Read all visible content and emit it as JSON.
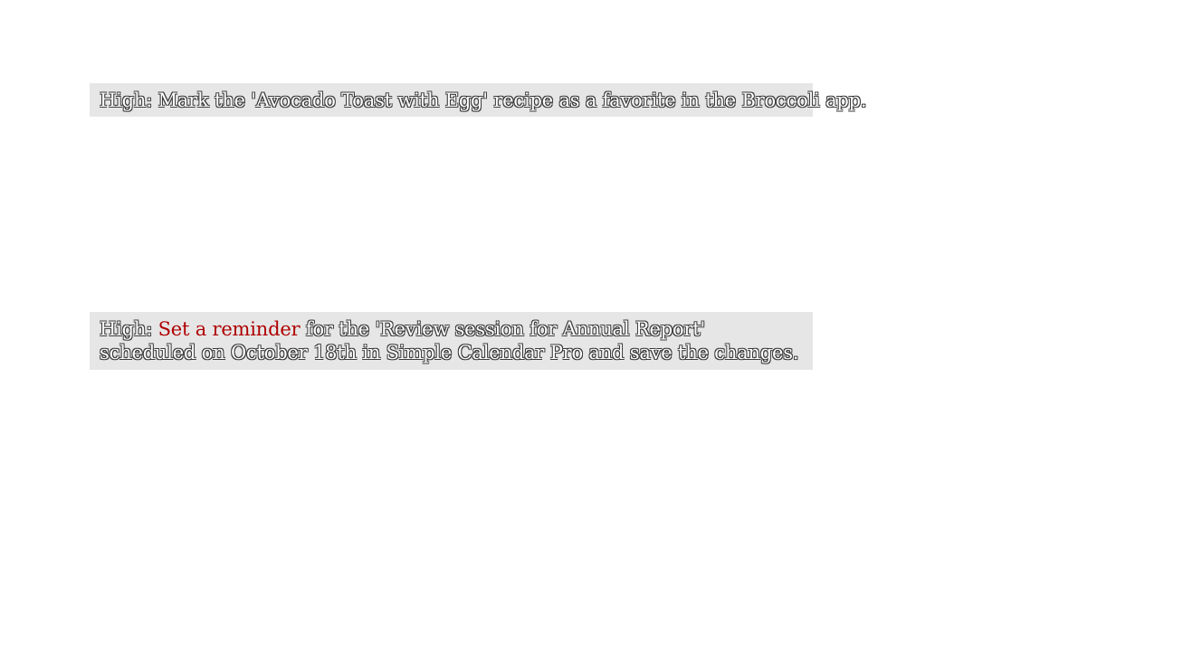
{
  "tasks": [
    {
      "priority": "High:",
      "text": "Mark the 'Avocado Toast with Egg' recipe as a favorite in the Broccoli app."
    },
    {
      "priority": "High:",
      "highlight": "Set a reminder",
      "text": "for the 'Review session for Annual Report' scheduled on October 18th in Simple Calendar Pro and save the changes."
    }
  ],
  "colors": {
    "card_background": "#e6e6e6",
    "highlight": "#b00000"
  }
}
